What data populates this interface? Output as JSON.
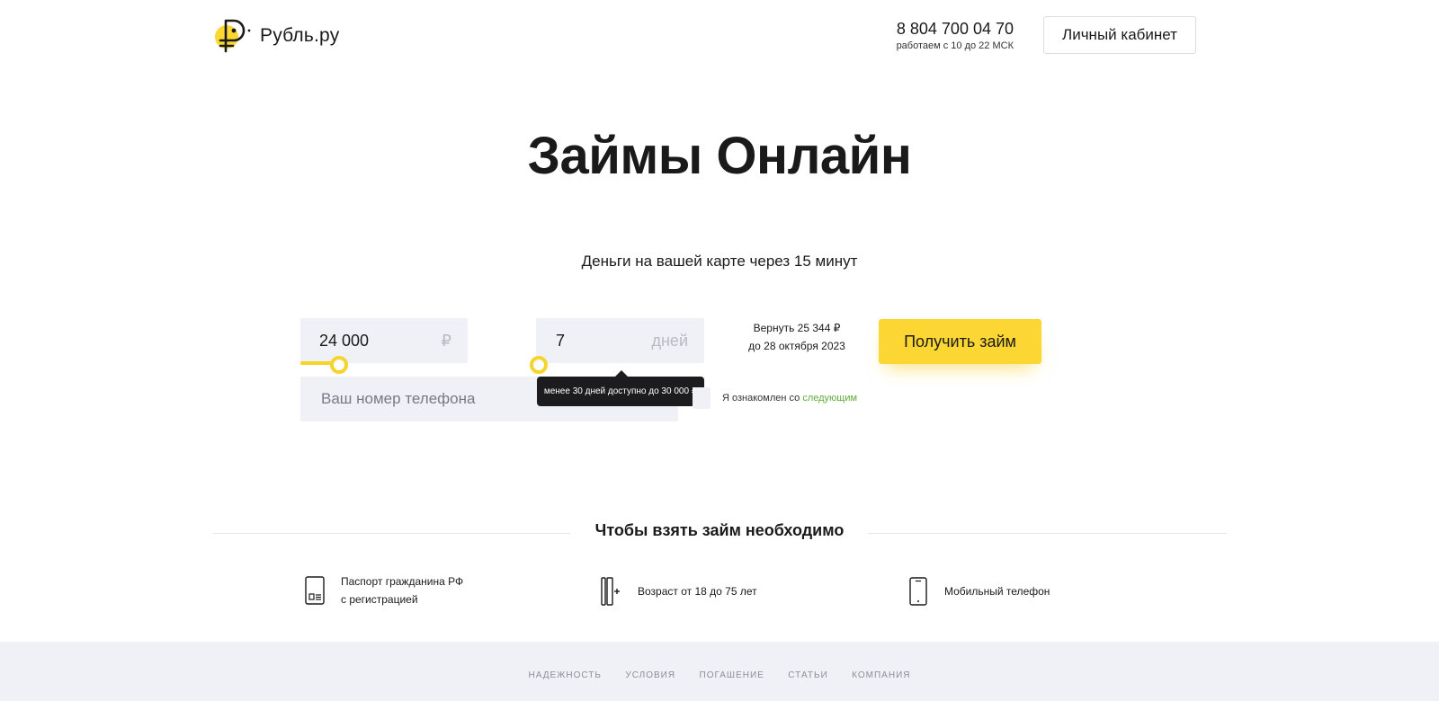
{
  "header": {
    "logo_text": "Рубль.ру",
    "phone": "8 804 700 04 70",
    "hours": "работаем с 10 до 22 МСК",
    "cabinet_label": "Личный кабинет"
  },
  "hero": {
    "title": "Займы Онлайн",
    "subtitle": "Деньги на вашей карте через 15 минут"
  },
  "form": {
    "amount_value": "24 000",
    "amount_unit": "₽",
    "days_value": "7",
    "days_unit": "дней",
    "phone_placeholder": "Ваш номер телефона",
    "tooltip": "менее 30 дней доступно до 30 000 ₽",
    "repay_line1": "Вернуть 25 344 ₽",
    "repay_line2": "до 28 октября 2023",
    "consent_text": "Я ознакомлен со",
    "consent_link": "следующим",
    "submit_label": "Получить займ"
  },
  "requirements": {
    "title": "Чтобы взять займ необходимо",
    "items": [
      {
        "line1": "Паспорт гражданина РФ",
        "line2": "с регистрацией",
        "icon": "passport-icon"
      },
      {
        "line1": "Возраст от 18 до 75 лет",
        "icon": "age-icon"
      },
      {
        "line1": "Мобильный телефон",
        "icon": "mobile-phone-icon"
      }
    ]
  },
  "footer": {
    "nav": [
      "НАДЕЖНОСТЬ",
      "УСЛОВИЯ",
      "ПОГАШЕНИЕ",
      "СТАТЬИ",
      "КОМПАНИЯ"
    ]
  },
  "colors": {
    "accent": "#fcd734",
    "field_bg": "#f0f1f6",
    "link_green": "#5faa3c",
    "tooltip_bg": "#1c1c1e"
  }
}
